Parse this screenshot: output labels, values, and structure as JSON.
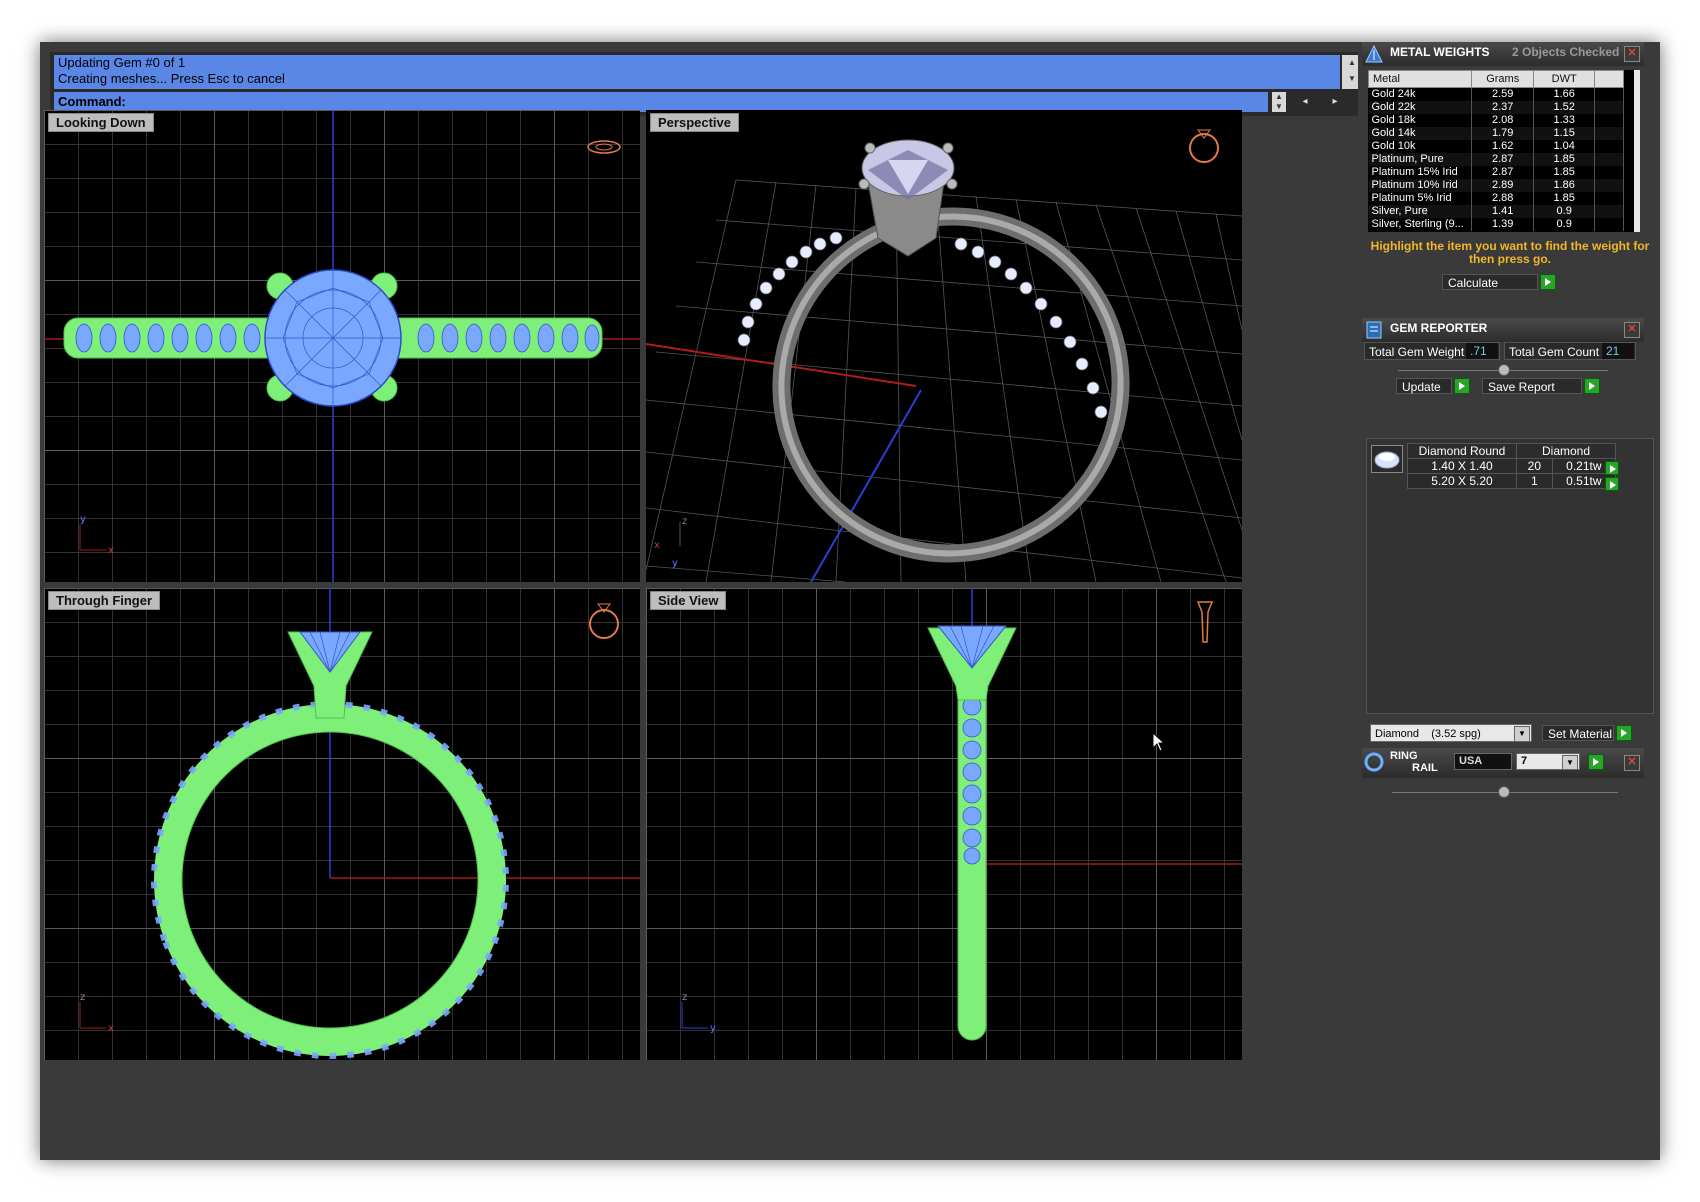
{
  "command": {
    "history": [
      "Updating Gem #0 of 1",
      "Creating meshes... Press Esc to cancel"
    ],
    "prompt_label": "Command:"
  },
  "viewports": [
    {
      "label": "Looking Down",
      "axes": [
        "y",
        "x"
      ]
    },
    {
      "label": "Perspective",
      "axes": [
        "z",
        "x",
        "y"
      ]
    },
    {
      "label": "Through Finger",
      "axes": [
        "z",
        "x"
      ]
    },
    {
      "label": "Side View",
      "axes": [
        "z",
        "y"
      ]
    }
  ],
  "metal_weights": {
    "title": "METAL WEIGHTS",
    "subtitle": "2 Objects Checked",
    "columns": [
      "Metal",
      "Grams",
      "DWT"
    ],
    "rows": [
      [
        "Gold 24k",
        "2.59",
        "1.66"
      ],
      [
        "Gold 22k",
        "2.37",
        "1.52"
      ],
      [
        "Gold 18k",
        "2.08",
        "1.33"
      ],
      [
        "Gold 14k",
        "1.79",
        "1.15"
      ],
      [
        "Gold 10k",
        "1.62",
        "1.04"
      ],
      [
        "Platinum, Pure",
        "2.87",
        "1.85"
      ],
      [
        "Platinum 15% Irid",
        "2.87",
        "1.85"
      ],
      [
        "Platinum 10% Irid",
        "2.89",
        "1.86"
      ],
      [
        "Platinum 5% Irid",
        "2.88",
        "1.85"
      ],
      [
        "Silver, Pure",
        "1.41",
        "0.9"
      ],
      [
        "Silver, Sterling (9...",
        "1.39",
        "0.9"
      ]
    ],
    "hint": "Highlight the item you want to find the weight for then press go.",
    "calculate_label": "Calculate"
  },
  "gem_reporter": {
    "title": "GEM REPORTER",
    "total_weight_label": "Total Gem Weight",
    "total_weight_value": ".71",
    "total_count_label": "Total Gem Count",
    "total_count_value": "21",
    "update_label": "Update",
    "save_report_label": "Save Report",
    "header": [
      "Diamond Round",
      "Diamond"
    ],
    "rows": [
      [
        "1.40 X 1.40",
        "20",
        "0.21tw"
      ],
      [
        "5.20 X 5.20",
        "1",
        "0.51tw"
      ]
    ],
    "material_select": "Diamond    (3.52 spg)",
    "set_material_label": "Set Material"
  },
  "ring_rail": {
    "title_line1": "RING",
    "title_line2": "RAIL",
    "country": "USA",
    "size": "7"
  },
  "colors": {
    "wire_green": "#7ef07a",
    "wire_blue": "#7aa8ff",
    "panel_bg": "#3a3a3a",
    "accent_orange": "#f1b72a"
  }
}
